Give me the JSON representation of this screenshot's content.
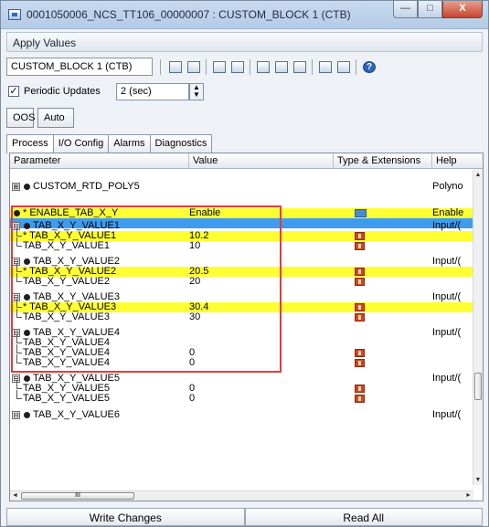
{
  "window": {
    "title": "0001050006_NCS_TT106_00000007 : CUSTOM_BLOCK 1 (CTB)",
    "minimize": "—",
    "maximize": "□",
    "close": "X"
  },
  "apply_header": "Apply Values",
  "toolbar": {
    "block_select": "CUSTOM_BLOCK 1 (CTB)",
    "icons": [
      "edit-icon",
      "edit-all-icon",
      "compare-icon",
      "snapshot-icon",
      "save-icon",
      "print-icon",
      "tree-icon",
      "view-list-icon",
      "view-grid-icon",
      "help-icon"
    ],
    "help_glyph": "?"
  },
  "periodic": {
    "label": "Periodic Updates",
    "checked": true,
    "check_glyph": "✓",
    "interval": "2 (sec)"
  },
  "modes": {
    "oos": "OOS",
    "auto": "Auto"
  },
  "tabs": [
    "Process",
    "I/O Config",
    "Alarms",
    "Diagnostics"
  ],
  "grid": {
    "headers": {
      "parameter": "Parameter",
      "value": "Value",
      "type": "Type & Extensions",
      "help": "Help"
    },
    "rows": [
      {
        "kind": "group",
        "expander": "⊞",
        "name": "CUSTOM_RTD_POLY5",
        "help": "Polyno"
      },
      {
        "kind": "param-hl",
        "name": "* ENABLE_TAB_X_Y",
        "value": "Enable",
        "ext": "enum",
        "help": "Enable"
      },
      {
        "kind": "group",
        "expander": "⊟",
        "name": "TAB_X_Y_VALUE1",
        "help": "Input/("
      },
      {
        "kind": "child-hl",
        "name": "* TAB_X_Y_VALUE1",
        "value": "10.2",
        "ext": "float"
      },
      {
        "kind": "child",
        "name": "TAB_X_Y_VALUE1",
        "value": "10",
        "ext": "float"
      },
      {
        "kind": "group",
        "expander": "⊟",
        "name": "TAB_X_Y_VALUE2",
        "help": "Input/("
      },
      {
        "kind": "child-hl",
        "name": "* TAB_X_Y_VALUE2",
        "value": "20.5",
        "ext": "float"
      },
      {
        "kind": "child",
        "name": "TAB_X_Y_VALUE2",
        "value": "20",
        "ext": "float"
      },
      {
        "kind": "group",
        "expander": "⊟",
        "name": "TAB_X_Y_VALUE3",
        "help": "Input/("
      },
      {
        "kind": "child-hl",
        "name": "* TAB_X_Y_VALUE3",
        "value": "30.4",
        "ext": "float"
      },
      {
        "kind": "child",
        "name": "TAB_X_Y_VALUE3",
        "value": "30",
        "ext": "float"
      },
      {
        "kind": "group",
        "expander": "⊟",
        "name": "TAB_X_Y_VALUE4",
        "help": "Input/("
      },
      {
        "kind": "child",
        "name": "TAB_X_Y_VALUE4",
        "value": "",
        "ext": ""
      },
      {
        "kind": "child",
        "name": "TAB_X_Y_VALUE4",
        "value": "0",
        "ext": "float"
      },
      {
        "kind": "child",
        "name": "TAB_X_Y_VALUE4",
        "value": "0",
        "ext": "float"
      },
      {
        "kind": "group",
        "expander": "⊟",
        "name": "TAB_X_Y_VALUE5",
        "help": "Input/("
      },
      {
        "kind": "child",
        "name": "TAB_X_Y_VALUE5",
        "value": "0",
        "ext": "float"
      },
      {
        "kind": "child",
        "name": "TAB_X_Y_VALUE5",
        "value": "0",
        "ext": "float"
      },
      {
        "kind": "group",
        "expander": "⊟",
        "name": "TAB_X_Y_VALUE6",
        "help": "Input/("
      }
    ],
    "hscroll_thumb": "III",
    "scroll_up": "▲",
    "scroll_down": "▼",
    "scroll_left": "◄",
    "scroll_right": "►"
  },
  "bottom": {
    "write": "Write Changes",
    "read": "Read All"
  }
}
